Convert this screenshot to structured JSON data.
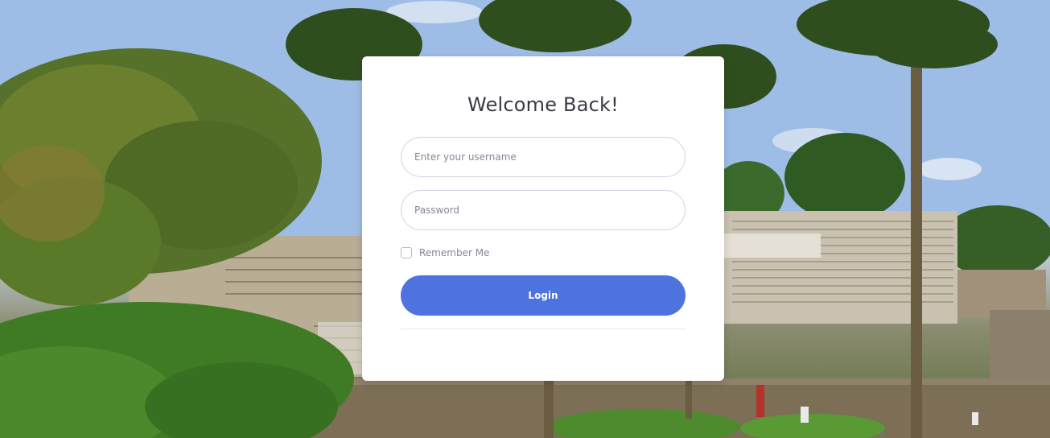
{
  "background": {
    "description_icon": "campus-photo"
  },
  "login_card": {
    "title": "Welcome Back!",
    "username": {
      "placeholder": "Enter your username",
      "value": ""
    },
    "password": {
      "placeholder": "Password",
      "value": ""
    },
    "remember_me": {
      "label": "Remember Me",
      "checked": false
    },
    "login_label": "Login"
  },
  "colors": {
    "primary": "#4e73df",
    "card": "#ffffff",
    "title_text": "#3a3b45",
    "muted_text": "#858796",
    "border": "#d1d3e2"
  }
}
